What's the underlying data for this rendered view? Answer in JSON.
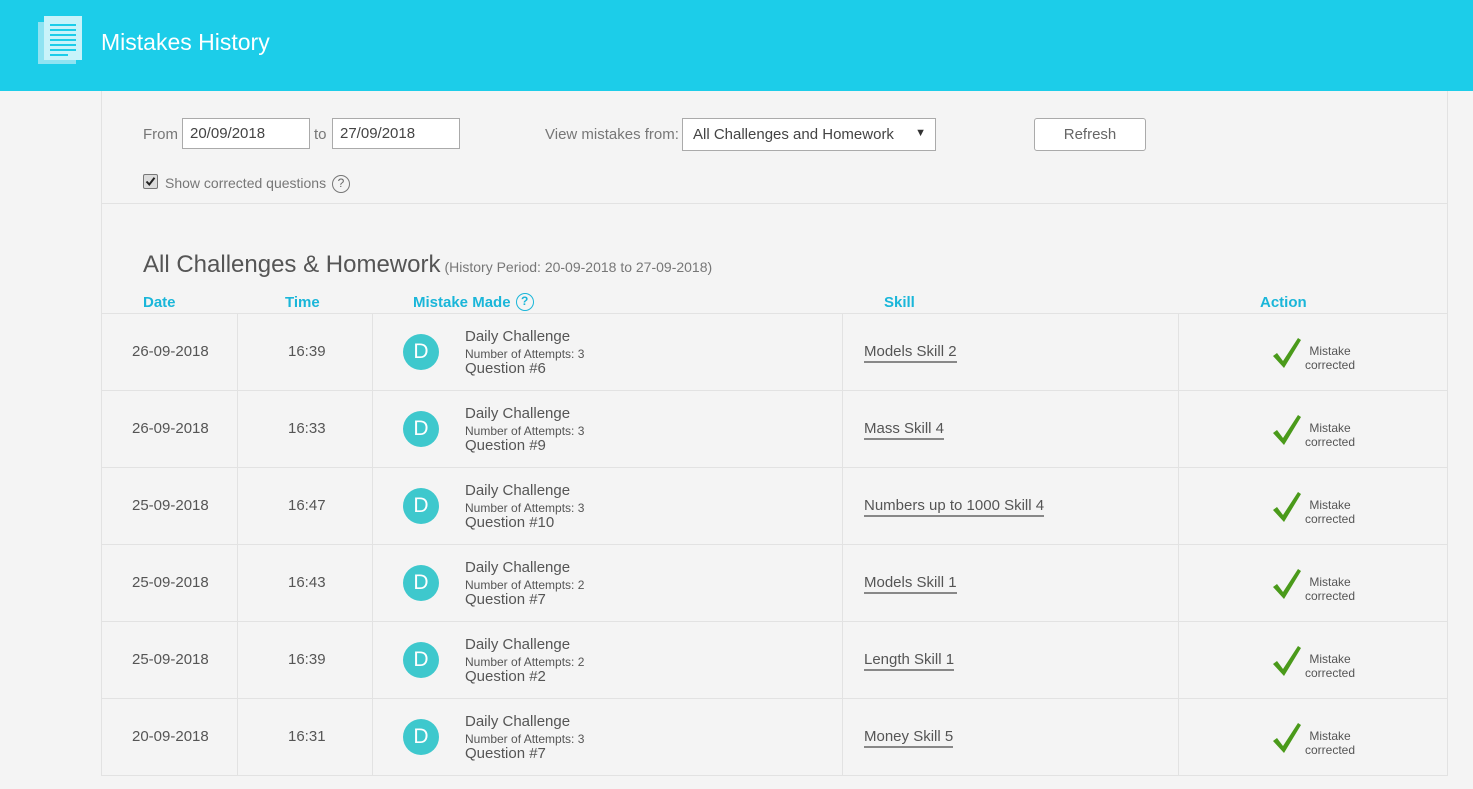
{
  "header": {
    "title": "Mistakes History",
    "icon": "document-list-icon",
    "color": "#1ccde9"
  },
  "filters": {
    "from_label": "From",
    "from_value": "20/09/2018",
    "to_label": "to",
    "to_value": "27/09/2018",
    "view_label": "View mistakes from:",
    "view_value": "All Challenges and Homework",
    "refresh_label": "Refresh",
    "show_corrected_label": "Show corrected questions",
    "show_corrected_checked": true,
    "help_glyph": "?"
  },
  "section": {
    "title": "All Challenges & Homework",
    "period": "(History Period: 20-09-2018 to 27-09-2018)"
  },
  "columns": {
    "date": "Date",
    "time": "Time",
    "mistake": "Mistake Made",
    "skill": "Skill",
    "action": "Action"
  },
  "rows": [
    {
      "date": "26-09-2018",
      "time": "16:39",
      "avatar": "D",
      "title": "Daily Challenge",
      "attempts": "Number of Attempts: 3",
      "question": "Question #6",
      "skill": "Models Skill 2",
      "status1": "Mistake",
      "status2": "corrected"
    },
    {
      "date": "26-09-2018",
      "time": "16:33",
      "avatar": "D",
      "title": "Daily Challenge",
      "attempts": "Number of Attempts: 3",
      "question": "Question #9",
      "skill": "Mass Skill 4",
      "status1": "Mistake",
      "status2": "corrected"
    },
    {
      "date": "25-09-2018",
      "time": "16:47",
      "avatar": "D",
      "title": "Daily Challenge",
      "attempts": "Number of Attempts: 3",
      "question": "Question #10",
      "skill": "Numbers up to 1000 Skill 4",
      "status1": "Mistake",
      "status2": "corrected"
    },
    {
      "date": "25-09-2018",
      "time": "16:43",
      "avatar": "D",
      "title": "Daily Challenge",
      "attempts": "Number of Attempts: 2",
      "question": "Question #7",
      "skill": "Models Skill 1",
      "status1": "Mistake",
      "status2": "corrected"
    },
    {
      "date": "25-09-2018",
      "time": "16:39",
      "avatar": "D",
      "title": "Daily Challenge",
      "attempts": "Number of Attempts: 2",
      "question": "Question #2",
      "skill": "Length Skill 1",
      "status1": "Mistake",
      "status2": "corrected"
    },
    {
      "date": "20-09-2018",
      "time": "16:31",
      "avatar": "D",
      "title": "Daily Challenge",
      "attempts": "Number of Attempts: 3",
      "question": "Question #7",
      "skill": "Money Skill 5",
      "status1": "Mistake",
      "status2": "corrected"
    }
  ],
  "colors": {
    "accent": "#1ab6d9",
    "avatar": "#3ec8cd",
    "check": "#4a9a1a"
  }
}
